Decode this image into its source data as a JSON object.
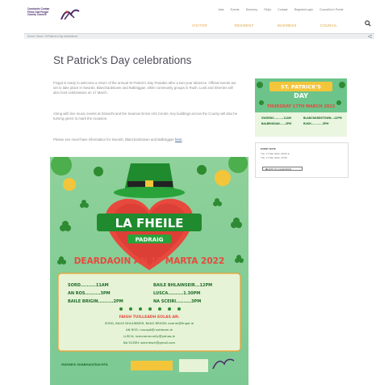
{
  "header": {
    "logo_text": "Comhairle Contae Fhine Gall Fingal County Council",
    "utility": [
      "Jobs",
      "Events",
      "Directory",
      "FAQs",
      "Contact",
      "Register/Login",
      "Councillor's Portal"
    ],
    "nav": [
      "VISITOR",
      "RESIDENT",
      "BUSINESS",
      "COUNCIL"
    ],
    "brand_color": "#4a2a6a",
    "accent_color": "#e8a43c"
  },
  "breadcrumb": "Home  /  News  /  St Patrick's Day celebrations",
  "page": {
    "title": "St Patrick's Day celebrations",
    "p1": "Fingal is ready to welcome a return of the annual St Patrick's Day Parades after a two-year absence. Official events are set to take place in Swords, Blanchardstown and Balbriggan, while community groups in Rush, Lusk and Skerries will also host celebrations on 17 March.",
    "p2": "Along with live music events at Draiocht and the Seamus Ennis Arts Centre, key buildings across the County will also be turning green to mark the occasion.",
    "p3_text": "Please see must-have information for Swords, Blanchardstown and Balbriggan ",
    "p3_link": "here",
    "p3_end": "."
  },
  "poster": {
    "title": "LA FHEILE",
    "subtitle": "PADRAIG",
    "date": "DEARDAOIN AN 17 MARTA 2022",
    "times_left": [
      "SORD..........11AM",
      "AN ROS..........3PM",
      "BAILE BRIGIN..........2PM"
    ],
    "times_right": [
      "BAILE BHLAINSEIR...12PM",
      "LUSCA..........1.30PM",
      "NA SCEIRI..........3PM"
    ],
    "info_heading": "FAIGH TUILLEADH EOLAS AR:",
    "info": [
      "SORD, BAILE BHLAINSEIR, BAILE BRIGIN: events@fingal.ie",
      "AN ROS: rususpt@rushteam.ie",
      "LUSCA: luskcommunity@yahoo.ie",
      "NA SCEIRI: skerriesch@gmail.com"
    ],
    "footer": "FAISNEIS SHABHAILTEACHTA"
  },
  "side": {
    "img_title_1": "ST. PATRICK'S",
    "img_title_2": "DAY",
    "img_date": "THURSDAY 17TH MARCH 2022",
    "img_lines": [
      "SWORDS..........11AM",
      "BALBRIGGAN......2PM",
      "BLANCHARDSTOWN...12PM",
      "RUSH............3PM"
    ]
  },
  "event": {
    "label": "EVENT DATE",
    "date1": "Thu, 17 Mar 2022, 09:00 to",
    "date2": "Thu, 17 Mar 2022, 23:59",
    "button": "ADD TO CALENDAR"
  }
}
